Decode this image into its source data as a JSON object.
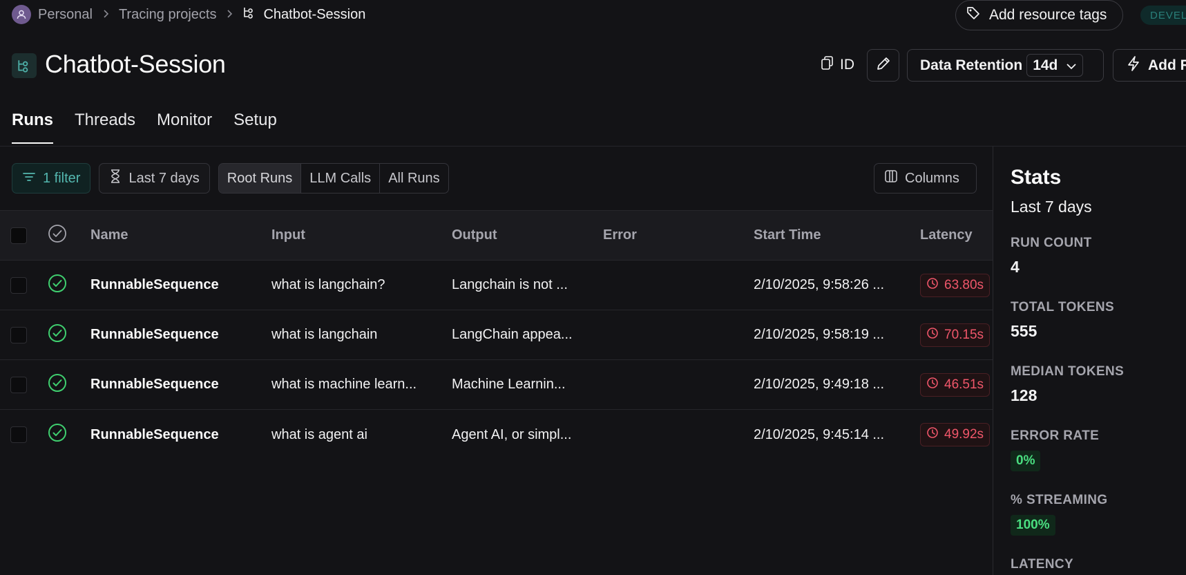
{
  "breadcrumb": {
    "items": [
      "Personal",
      "Tracing projects",
      "Chatbot-Session"
    ]
  },
  "header": {
    "tags_button": "Add resource tags",
    "env_badge": "DEVEL",
    "title": "Chatbot-Session",
    "id_label": "ID",
    "retention_label": "Data Retention",
    "retention_value": "14d",
    "add_rule_label": "Add R"
  },
  "tabs": [
    "Runs",
    "Threads",
    "Monitor",
    "Setup"
  ],
  "toolbar": {
    "filter_label": "1 filter",
    "date_label": "Last 7 days",
    "segments": [
      "Root Runs",
      "LLM Calls",
      "All Runs"
    ],
    "columns_label": "Columns"
  },
  "table": {
    "headers": {
      "name": "Name",
      "input": "Input",
      "output": "Output",
      "error": "Error",
      "start_time": "Start Time",
      "latency": "Latency"
    },
    "rows": [
      {
        "name": "RunnableSequence",
        "input": "what is langchain?",
        "output": "Langchain is not ...",
        "error": "",
        "start_time": "2/10/2025, 9:58:26 ...",
        "latency": "63.80s"
      },
      {
        "name": "RunnableSequence",
        "input": "what is langchain",
        "output": "LangChain appea...",
        "error": "",
        "start_time": "2/10/2025, 9:58:19 ...",
        "latency": "70.15s"
      },
      {
        "name": "RunnableSequence",
        "input": "what is machine learn...",
        "output": "Machine Learnin...",
        "error": "",
        "start_time": "2/10/2025, 9:49:18 ...",
        "latency": "46.51s"
      },
      {
        "name": "RunnableSequence",
        "input": "what is agent ai",
        "output": "Agent AI, or simpl...",
        "error": "",
        "start_time": "2/10/2025, 9:45:14 ...",
        "latency": "49.92s"
      }
    ]
  },
  "stats": {
    "title": "Stats",
    "subtitle": "Last 7 days",
    "run_count_label": "RUN COUNT",
    "run_count": "4",
    "total_tokens_label": "TOTAL TOKENS",
    "total_tokens": "555",
    "median_tokens_label": "MEDIAN TOKENS",
    "median_tokens": "128",
    "error_rate_label": "ERROR RATE",
    "error_rate": "0%",
    "streaming_label": "% STREAMING",
    "streaming": "100%",
    "latency_label": "LATENCY"
  },
  "colors": {
    "accent_teal": "#54b8b0",
    "success_green": "#4ade80",
    "latency_red": "#f0566a",
    "background": "#131316"
  }
}
